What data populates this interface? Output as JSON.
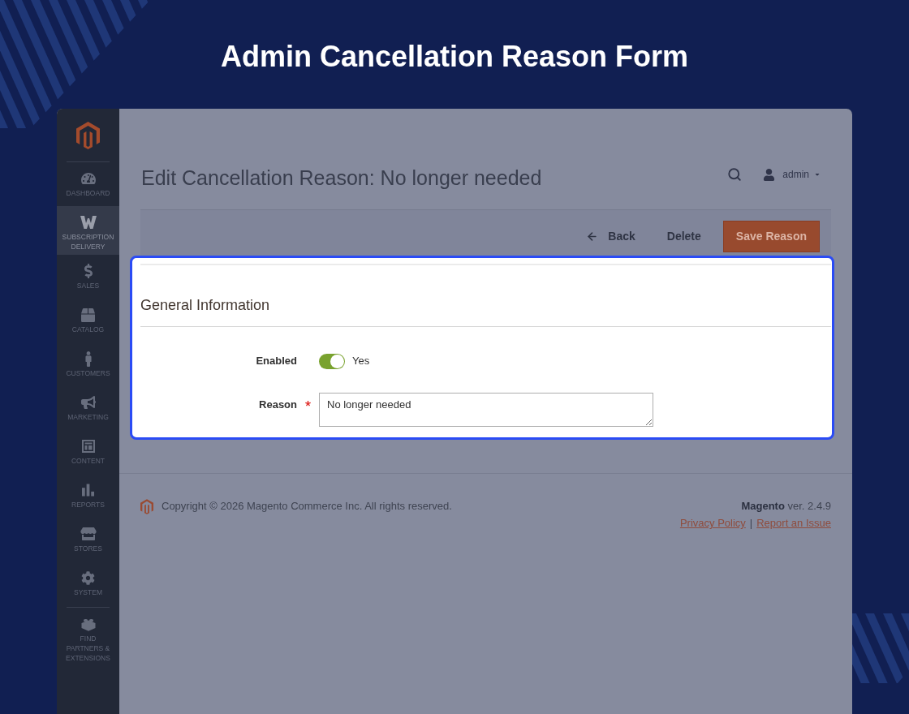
{
  "page_title": "Admin Cancellation Reason Form",
  "sidebar": {
    "items": [
      {
        "label": "DASHBOARD",
        "selected": false
      },
      {
        "label": "SUBSCRIPTION DELIVERY",
        "selected": true
      },
      {
        "label": "SALES",
        "selected": false
      },
      {
        "label": "CATALOG",
        "selected": false
      },
      {
        "label": "CUSTOMERS",
        "selected": false
      },
      {
        "label": "MARKETING",
        "selected": false
      },
      {
        "label": "CONTENT",
        "selected": false
      },
      {
        "label": "REPORTS",
        "selected": false
      },
      {
        "label": "STORES",
        "selected": false
      },
      {
        "label": "SYSTEM",
        "selected": false
      }
    ],
    "extra_items": [
      {
        "label": "FIND PARTNERS & EXTENSIONS",
        "selected": false
      }
    ]
  },
  "header": {
    "title": "Edit Cancellation Reason: No longer needed",
    "user": "admin"
  },
  "actions": [
    {
      "label": "Back",
      "kind": "back"
    },
    {
      "label": "Delete",
      "kind": "plain"
    },
    {
      "label": "Save Reason",
      "kind": "primary"
    }
  ],
  "form": {
    "highlighted": true,
    "title": "General Information",
    "fields": [
      {
        "kind": "toggle",
        "label": "Enabled",
        "required": false,
        "on": true,
        "value": "Yes"
      },
      {
        "kind": "textarea",
        "label": "Reason",
        "required": true,
        "value": "No longer needed"
      }
    ]
  },
  "footer": {
    "copyright": "Copyright © 2026 Magento Commerce Inc. All rights reserved.",
    "version": "**Magento** ver. 2.4.9",
    "links": [
      "Privacy Policy",
      "Report an Issue"
    ],
    "link_separator": "|"
  }
}
